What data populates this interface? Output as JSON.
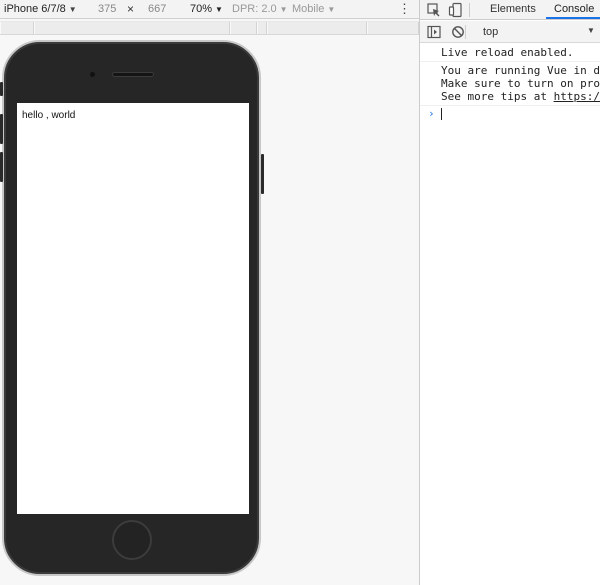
{
  "device_toolbar": {
    "device_name": "iPhone 6/7/8",
    "width": "375",
    "times": "×",
    "height": "667",
    "zoom": "70%",
    "dpr": "DPR: 2.0",
    "mode": "Mobile",
    "caret": "▼",
    "more": "⋮"
  },
  "phone": {
    "screen_text": "hello , world"
  },
  "devtools": {
    "tabs": [
      {
        "label": "Elements"
      },
      {
        "label": "Console"
      }
    ],
    "context": "top",
    "caret": "▼",
    "prompt": "›",
    "messages": [
      {
        "lines": [
          "Live reload enabled."
        ]
      },
      {
        "lines": [
          "You are running Vue in development mode.",
          "Make sure to turn on production mode when deploying for production.",
          "See more tips at "
        ],
        "link": "https://vuejs.org/guide/deployment.html"
      }
    ]
  },
  "icons": {
    "inspect": "inspect-element-icon",
    "device": "device-toggle-icon",
    "sidebar": "console-sidebar-icon",
    "clear": "clear-console-icon"
  },
  "colors": {
    "accent": "#1a73e8",
    "phone_body": "#262626",
    "toolbar_bg": "#f3f3f3"
  }
}
